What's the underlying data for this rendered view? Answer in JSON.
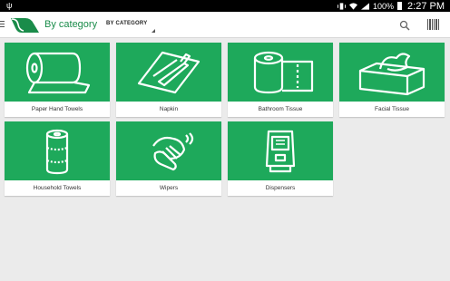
{
  "status_bar": {
    "battery_percent": "100%",
    "time": "2:27 PM"
  },
  "app_bar": {
    "title": "By category",
    "dropdown_selected": "BY CATEGORY"
  },
  "colors": {
    "brand_green": "#1ea95b",
    "title_green": "#1a8c4a"
  },
  "categories": [
    {
      "label": "Paper Hand Towels",
      "icon": "paper-hand-towels-icon"
    },
    {
      "label": "Napkin",
      "icon": "napkin-icon"
    },
    {
      "label": "Bathroom Tissue",
      "icon": "bathroom-tissue-icon"
    },
    {
      "label": "Facial Tissue",
      "icon": "facial-tissue-icon"
    },
    {
      "label": "Household Towels",
      "icon": "household-towels-icon"
    },
    {
      "label": "Wipers",
      "icon": "wipers-icon"
    },
    {
      "label": "Dispensers",
      "icon": "dispensers-icon"
    }
  ]
}
